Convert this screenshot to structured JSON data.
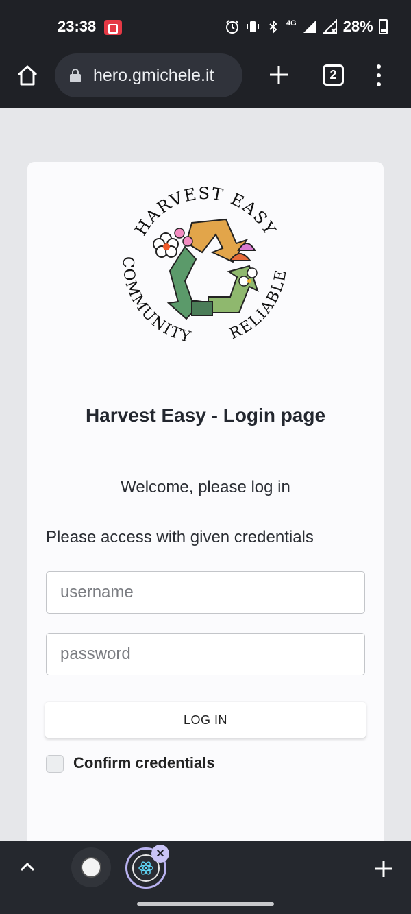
{
  "status_bar": {
    "time": "23:38",
    "network": "4G",
    "battery": "28%"
  },
  "browser": {
    "url": "hero.gmichele.it",
    "tab_count": "2"
  },
  "logo": {
    "top_text": "HARVEST EASY",
    "left_text": "COMMUNITY",
    "right_text": "RELIABLE"
  },
  "login": {
    "title": "Harvest Easy - Login page",
    "welcome": "Welcome, please log in",
    "instruction": "Please access with given credentials",
    "username_placeholder": "username",
    "password_placeholder": "password",
    "button_label": "LOG IN",
    "checkbox_label": "Confirm credentials",
    "checkbox_checked": false
  },
  "colors": {
    "chrome_dark": "#1f2126",
    "page_bg": "#e6e7ea",
    "card_bg": "#fbfbfd",
    "tab_accent": "#b9b2f0"
  },
  "icons": {
    "home": "home-icon",
    "lock": "lock-icon",
    "new_tab": "plus-icon",
    "tabs": "tab-switcher-icon",
    "menu": "more-vert-icon",
    "close_tab": "close-icon"
  }
}
